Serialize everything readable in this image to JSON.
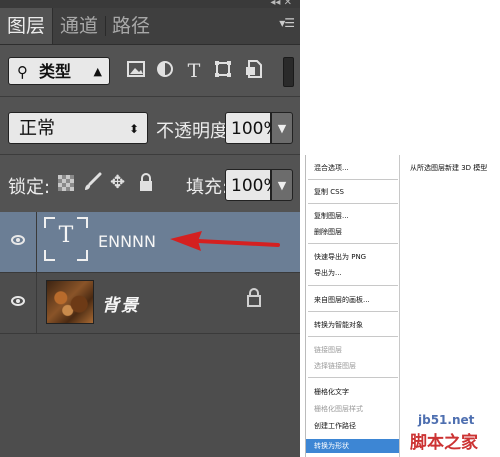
{
  "panel": {
    "tabs": [
      "图层",
      "通道",
      "路径"
    ],
    "menu_icon": "panel-menu-icon",
    "filter": {
      "kind_label": "类型",
      "icons": [
        "image-filter-icon",
        "adjustment-filter-icon",
        "type-filter-icon",
        "shape-filter-icon",
        "smart-object-filter-icon"
      ]
    },
    "blend_mode": "正常",
    "opacity_label": "不透明度:",
    "opacity_value": "100%",
    "lock_label": "锁定:",
    "lock_icons": [
      "lock-transparent-icon",
      "lock-brush-icon",
      "lock-position-icon",
      "lock-all-icon"
    ],
    "fill_label": "填充:",
    "fill_value": "100%"
  },
  "layers": [
    {
      "name": "ENNNN",
      "type": "text",
      "thumb_glyph": "T",
      "selected": true
    },
    {
      "name": "背景",
      "type": "image",
      "locked": true
    }
  ],
  "context_menu": {
    "left_items": [
      {
        "label": "混合选项...",
        "enabled": true
      },
      {
        "label": "复制 CSS",
        "enabled": true
      },
      {
        "label": "复制图层...",
        "enabled": true
      },
      {
        "label": "删除图层",
        "enabled": true
      },
      {
        "label": "快速导出为 PNG",
        "enabled": true
      },
      {
        "label": "导出为...",
        "enabled": true
      },
      {
        "label": "来自图层的画板...",
        "enabled": true
      },
      {
        "label": "转换为智能对象",
        "enabled": true
      },
      {
        "label": "链接图层",
        "enabled": false
      },
      {
        "label": "选择链接图层",
        "enabled": false
      },
      {
        "label": "栅格化文字",
        "enabled": true
      },
      {
        "label": "栅格化图层样式",
        "enabled": false
      },
      {
        "label": "创建工作路径",
        "enabled": true
      },
      {
        "label": "转换为形状",
        "enabled": true,
        "highlighted": true
      }
    ],
    "right_item": "从所选图层新建 3D 模型"
  },
  "watermark": {
    "site": "jb51.net",
    "name": "脚本之家"
  },
  "colors": {
    "panel_bg": "#535353",
    "selected_layer": "#6b7e95",
    "arrow": "#d42020",
    "menu_highlight": "#3d86d4"
  }
}
